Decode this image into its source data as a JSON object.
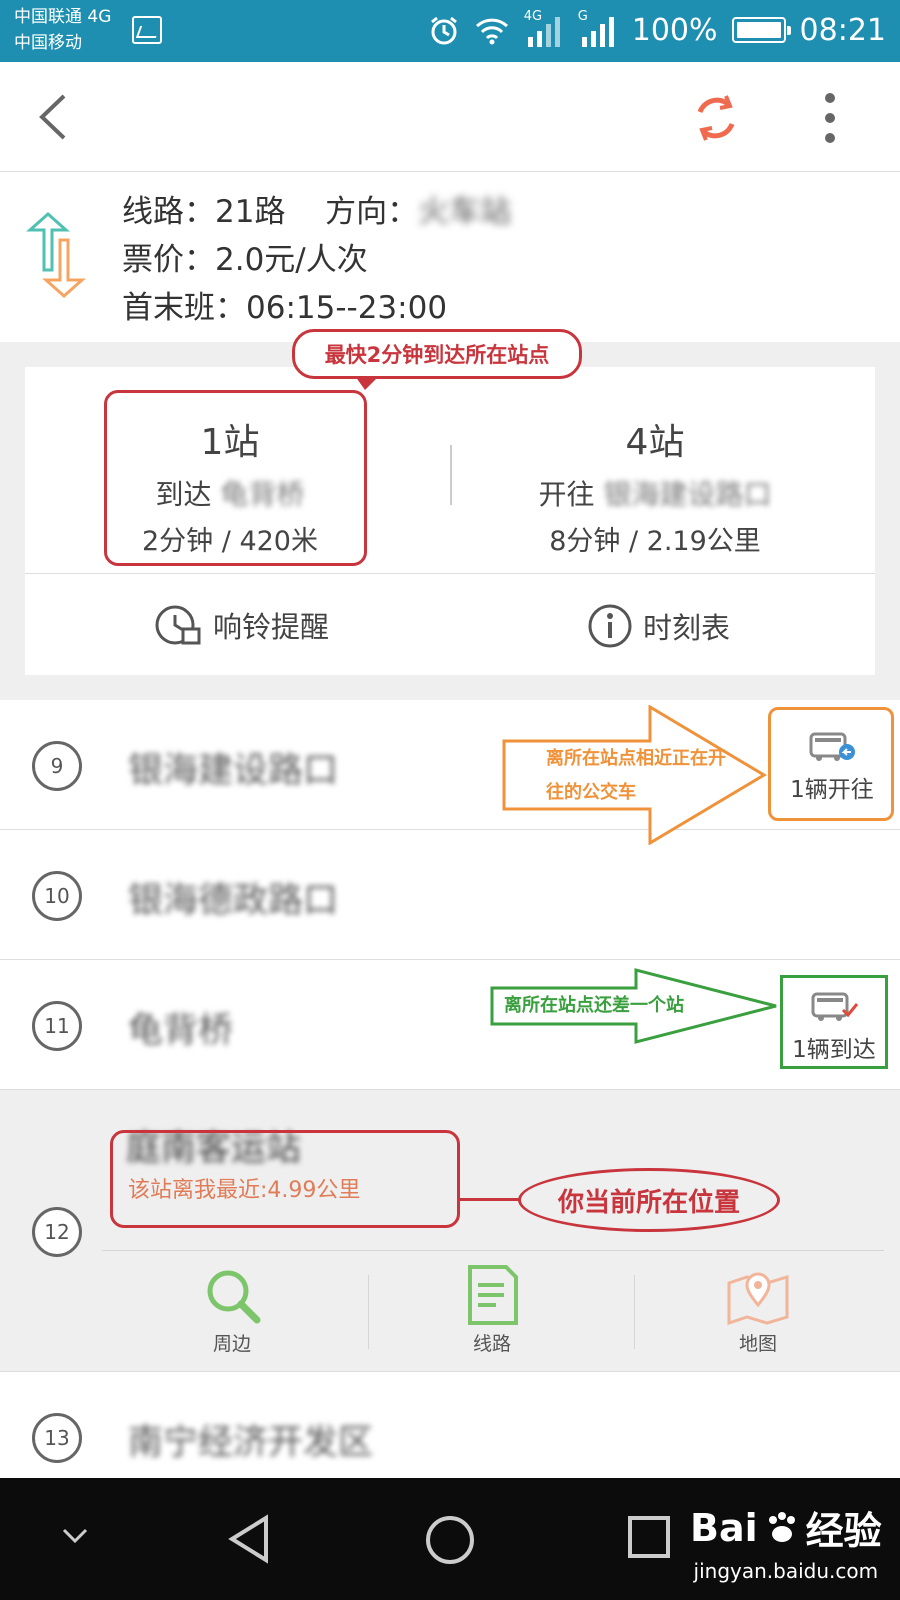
{
  "status_bar": {
    "carrier1": "中国联通 4G",
    "carrier2": "中国移动",
    "net1": "4G",
    "net2": "G",
    "battery": "100%",
    "time": "08:21"
  },
  "line_info": {
    "line_label": "线路：",
    "line_value": "21路",
    "dir_label": "方向：",
    "dir_value": "火车站",
    "fare_label": "票价：",
    "fare_value": "2.0元/人次",
    "hours_label": "首末班：",
    "hours_value": "06:15--23:00"
  },
  "arrival": {
    "left": {
      "stops": "1站",
      "line": "到达",
      "stop_name": "龟背桥",
      "detail": "2分钟 / 420米"
    },
    "right": {
      "stops": "4站",
      "line": "开往",
      "stop_name": "银海建设路口",
      "detail": "8分钟 / 2.19公里"
    },
    "actions": {
      "alarm": "响铃提醒",
      "timetable": "时刻表"
    }
  },
  "annotations": {
    "fastest": "最快2分钟到达所在站点",
    "heading_bus_1": "离所在站点相近正在开",
    "heading_bus_2": "往的公交车",
    "one_stop": "离所在站点还差一个站",
    "current_pos": "你当前所在位置"
  },
  "stops": [
    {
      "num": "9",
      "name": "银海建设路口",
      "vehicle": "1辆开往"
    },
    {
      "num": "10",
      "name": "银海德政路口"
    },
    {
      "num": "11",
      "name": "龟背桥",
      "vehicle": "1辆到达"
    },
    {
      "num": "12",
      "name": "庭南客运站",
      "distance": "该站离我最近:4.99公里"
    },
    {
      "num": "13",
      "name": "南宁经济开发区"
    }
  ],
  "current_stop_tools": {
    "nearby": "周边",
    "route": "线路",
    "map": "地图"
  },
  "watermark": {
    "brand": "Bai",
    "brand_cn": "经验",
    "url": "jingyan.baidu.com"
  },
  "colors": {
    "status_bar": "#1e8fb0",
    "red": "#c9353d",
    "orange": "#f0923a",
    "green": "#3a9f3e",
    "distance": "#e07c57"
  }
}
